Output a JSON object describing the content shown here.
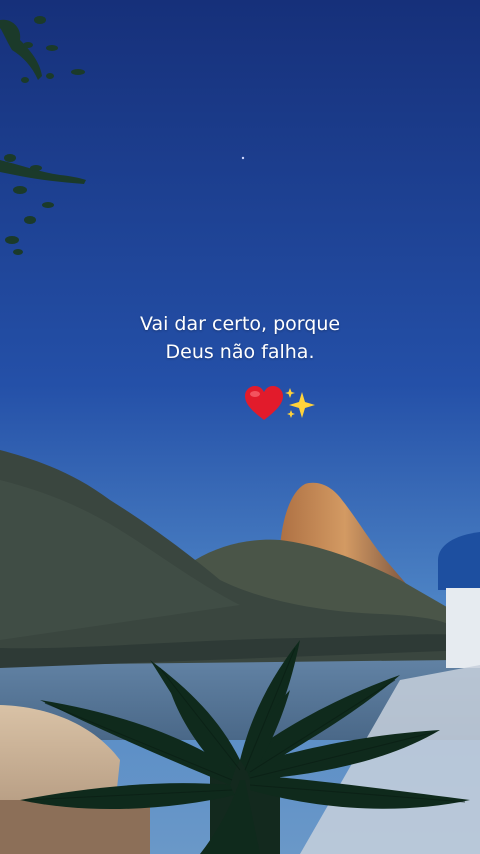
{
  "caption": {
    "line1": "Vai dar certo, porque",
    "line2": "Deus não falha."
  },
  "emojis": [
    "heart-icon",
    "sparkles-icon"
  ],
  "colors": {
    "sky_top": "#16307a",
    "sky_mid": "#2450a8",
    "sky_bottom": "#4f86c6",
    "sugarloaf": "#c98a57",
    "hills": "#3c4a45",
    "water": "#5f7fa0",
    "palm": "#0f2a1c",
    "heart": "#e21b2b",
    "sparkle": "#ffd23a"
  }
}
